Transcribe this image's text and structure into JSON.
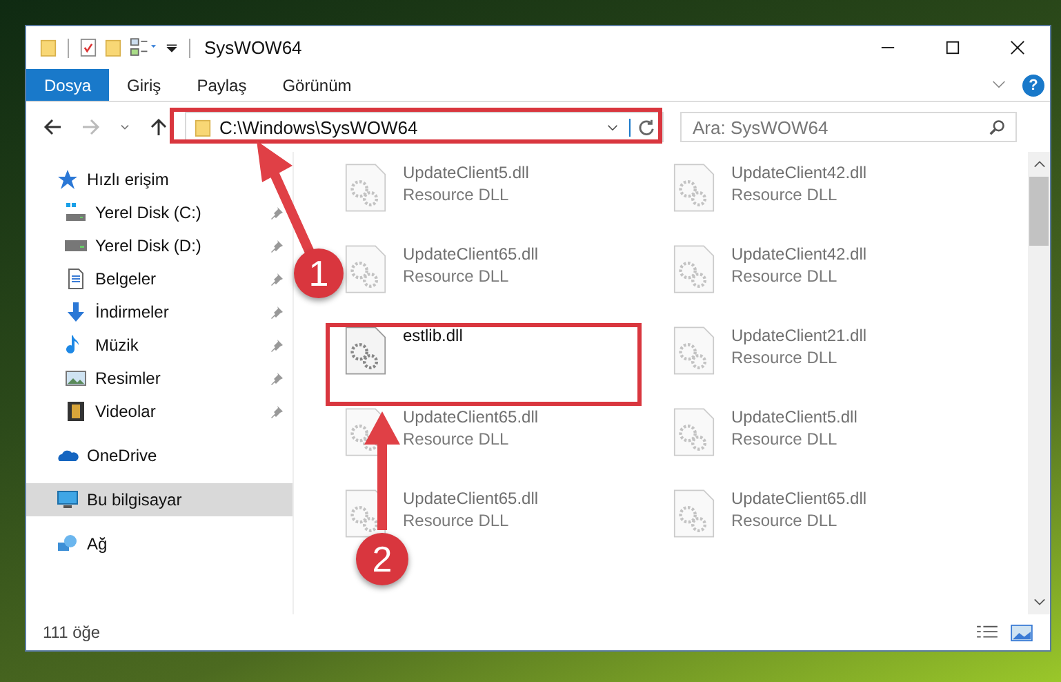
{
  "window": {
    "title": "SysWOW64"
  },
  "ribbon": {
    "tabs": [
      {
        "label": "Dosya",
        "selected": true
      },
      {
        "label": "Giriş",
        "selected": false
      },
      {
        "label": "Paylaş",
        "selected": false
      },
      {
        "label": "Görünüm",
        "selected": false
      }
    ],
    "help": "?"
  },
  "address_bar": {
    "path": "C:\\Windows\\SysWOW64"
  },
  "search": {
    "placeholder": "Ara: SysWOW64"
  },
  "sidebar": {
    "items": [
      {
        "label": "Hızlı erişim",
        "selected": false,
        "children": [
          {
            "label": "Yerel Disk (C:)",
            "pinned": true
          },
          {
            "label": "Yerel Disk (D:)",
            "pinned": true
          },
          {
            "label": "Belgeler",
            "pinned": true
          },
          {
            "label": "İndirmeler",
            "pinned": true
          },
          {
            "label": "Müzik",
            "pinned": true
          },
          {
            "label": "Resimler",
            "pinned": true
          },
          {
            "label": "Videolar",
            "pinned": true
          }
        ]
      },
      {
        "label": "OneDrive",
        "selected": false
      },
      {
        "label": "Bu bilgisayar",
        "selected": true
      },
      {
        "label": "Ağ",
        "selected": false
      }
    ]
  },
  "files": [
    {
      "name": "UpdateClient5.dll",
      "type": "Resource DLL",
      "faded": true
    },
    {
      "name": "UpdateClient42.dll",
      "type": "Resource DLL",
      "faded": true
    },
    {
      "name": "UpdateClient65.dll",
      "type": "Resource DLL",
      "faded": true
    },
    {
      "name": "UpdateClient42.dll",
      "type": "Resource DLL",
      "faded": true
    },
    {
      "name": "estlib.dll",
      "faded": false
    },
    {
      "name": "UpdateClient21.dll",
      "type": "Resource DLL",
      "faded": true
    },
    {
      "name": "UpdateClient65.dll",
      "type": "Resource DLL",
      "faded": true
    },
    {
      "name": "UpdateClient5.dll",
      "type": "Resource DLL",
      "faded": true
    },
    {
      "name": "UpdateClient65.dll",
      "type": "Resource DLL",
      "faded": true
    },
    {
      "name": "UpdateClient65.dll",
      "type": "Resource DLL",
      "faded": true
    }
  ],
  "status_bar": {
    "count": "111 öğe"
  },
  "annotations": [
    {
      "label": "1"
    },
    {
      "label": "2"
    }
  ]
}
